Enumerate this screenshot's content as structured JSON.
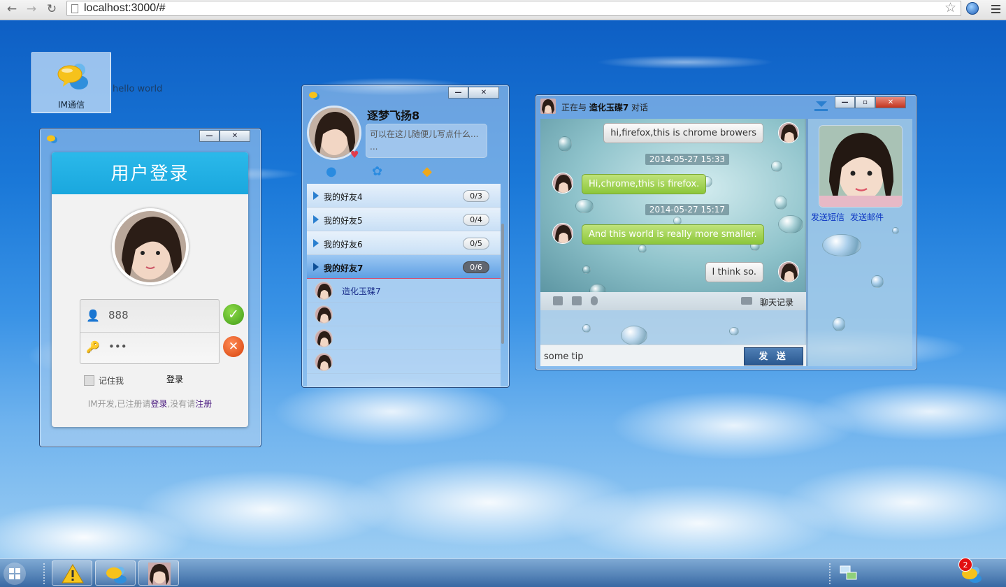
{
  "browser": {
    "url": "localhost:3000/#"
  },
  "desktop": {
    "icon_label": "IM通信",
    "hello_text": "hello world"
  },
  "login": {
    "title": "用户登录",
    "username": "888",
    "password": "•••",
    "remember_label": "记住我",
    "login_button": "登录",
    "footer_prefix": "IM开发,已注册请",
    "footer_login": "登录",
    "footer_mid": ",没有请",
    "footer_register": "注册"
  },
  "friends": {
    "nickname": "逐梦飞扬8",
    "signature": "可以在这儿随便儿写点什么...\n...",
    "groups": [
      {
        "name": "我的好友4",
        "count": "0/3",
        "active": false
      },
      {
        "name": "我的好友5",
        "count": "0/4",
        "active": false
      },
      {
        "name": "我的好友6",
        "count": "0/5",
        "active": false
      },
      {
        "name": "我的好友7",
        "count": "0/6",
        "active": true
      }
    ],
    "members": [
      {
        "name": "造化玉碟7"
      },
      {
        "name": ""
      },
      {
        "name": ""
      },
      {
        "name": ""
      }
    ]
  },
  "chat": {
    "title_prefix": "正在与",
    "contact": "造化玉碟7",
    "title_suffix": "对话",
    "messages": [
      {
        "from": "me",
        "text": "hi,firefox,this is chrome browers"
      },
      {
        "type": "time",
        "text": "2014-05-27 15:33"
      },
      {
        "from": "them",
        "text": "Hi,chrome,this is firefox."
      },
      {
        "type": "time",
        "text": "2014-05-27 15:17"
      },
      {
        "from": "them",
        "text": "And this world is really more smaller."
      },
      {
        "from": "me",
        "text": "I think so."
      }
    ],
    "history_label": "聊天记录",
    "input_tip": "some tip",
    "send_label": "发 送",
    "side_sms": "发送短信",
    "side_mail": "发送邮件"
  },
  "taskbar": {
    "badge_count": "2"
  },
  "colors": {
    "accent": "#1aa7de",
    "bubble_green": "#8cc63a",
    "link": "#0b34c2"
  }
}
